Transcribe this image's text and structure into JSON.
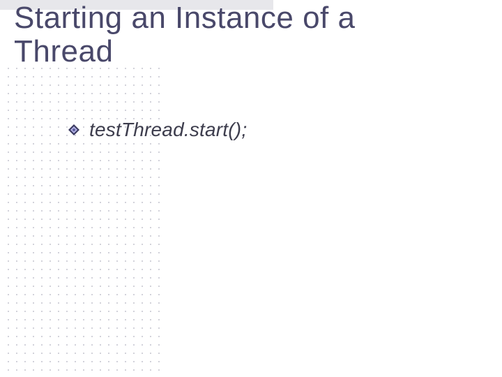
{
  "title": "Starting an Instance of a Thread",
  "bullets": [
    {
      "text": "testThread.start();"
    }
  ],
  "colors": {
    "title": "#49486a",
    "body": "#3d3d4d",
    "bullet_outer": "#3a3960",
    "bullet_inner": "#8f8fd0",
    "grid_dot": "#b8b8c4"
  }
}
